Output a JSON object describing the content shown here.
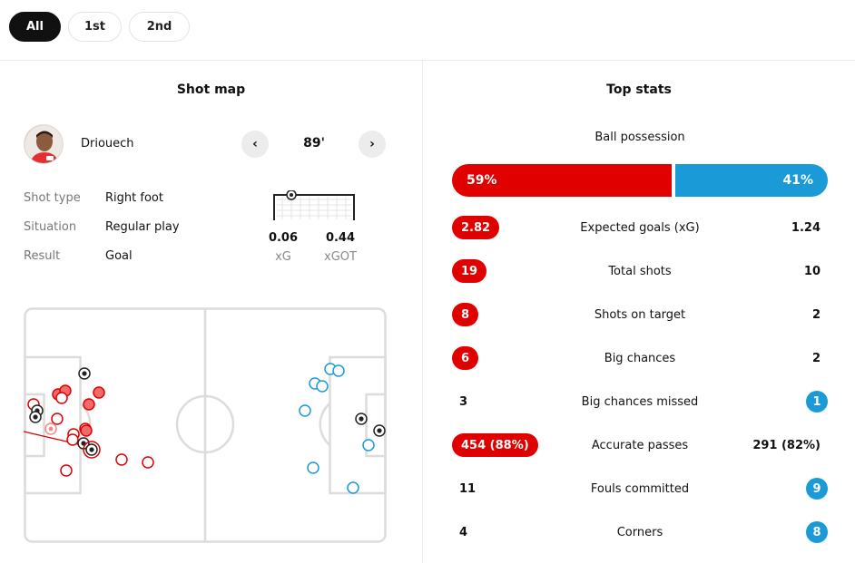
{
  "period_tabs": [
    "All",
    "1st",
    "2nd"
  ],
  "shot_map": {
    "title": "Shot map",
    "player": "Driouech",
    "minute": "89'",
    "details": [
      {
        "label": "Shot type",
        "value": "Right foot"
      },
      {
        "label": "Situation",
        "value": "Regular play"
      },
      {
        "label": "Result",
        "value": "Goal"
      }
    ],
    "xg": {
      "value": "0.06",
      "label": "xG"
    },
    "xgot": {
      "value": "0.44",
      "label": "xGOT"
    }
  },
  "top_stats": {
    "title": "Top stats",
    "possession": {
      "label": "Ball possession",
      "home": "59%",
      "away": "41%",
      "home_pct": 59
    },
    "rows": [
      {
        "name": "Expected goals (xG)",
        "home": "2.82",
        "away": "1.24",
        "highlight": "home"
      },
      {
        "name": "Total shots",
        "home": "19",
        "away": "10",
        "highlight": "home"
      },
      {
        "name": "Shots on target",
        "home": "8",
        "away": "2",
        "highlight": "home"
      },
      {
        "name": "Big chances",
        "home": "6",
        "away": "2",
        "highlight": "home"
      },
      {
        "name": "Big chances missed",
        "home": "3",
        "away": "1",
        "highlight": "away"
      },
      {
        "name": "Accurate passes",
        "home": "454 (88%)",
        "away": "291 (82%)",
        "highlight": "home"
      },
      {
        "name": "Fouls committed",
        "home": "11",
        "away": "9",
        "highlight": "away"
      },
      {
        "name": "Corners",
        "home": "4",
        "away": "8",
        "highlight": "away"
      }
    ]
  },
  "colors": {
    "home": "#e00000",
    "away": "#1a9ad6",
    "active_tab": "#111111"
  }
}
